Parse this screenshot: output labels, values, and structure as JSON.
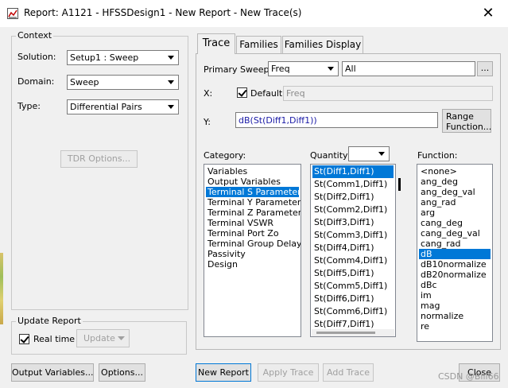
{
  "window": {
    "title": "Report: A1121 - HFSSDesign1 - New Report - New Trace(s)",
    "close_glyph": "✕"
  },
  "context": {
    "group_label": "Context",
    "solution": {
      "label": "Solution:",
      "value": "Setup1 : Sweep"
    },
    "domain": {
      "label": "Domain:",
      "value": "Sweep"
    },
    "type": {
      "label": "Type:",
      "value": "Differential Pairs"
    },
    "tdr_button": "TDR Options..."
  },
  "update_report": {
    "group_label": "Update Report",
    "realtime_label": "Real time",
    "realtime_checked": true,
    "update_button": "Update"
  },
  "bottom_left": {
    "output_variables": "Output Variables...",
    "options": "Options..."
  },
  "tabs": [
    {
      "label": "Trace",
      "active": true
    },
    {
      "label": "Families"
    },
    {
      "label": "Families Display"
    }
  ],
  "trace": {
    "primary_sweep_label": "Primary Sweep:",
    "primary_sweep_value": "Freq",
    "sweep_range": "All",
    "ellipsis": "...",
    "x_label": "X:",
    "default_label": "Default",
    "default_checked": true,
    "x_value": "Freq",
    "y_label": "Y:",
    "y_value": "dB(St(Diff1,Diff1))",
    "range_button_line1": "Range",
    "range_button_line2": "Function..."
  },
  "category": {
    "label": "Category:",
    "items": [
      "Variables",
      "Output Variables",
      "Terminal S Parameter",
      "Terminal Y Parameter",
      "Terminal Z Parameter",
      "Terminal VSWR",
      "Terminal Port Zo",
      "Terminal Group Delay",
      "Passivity",
      "Design"
    ],
    "selected_index": 2
  },
  "quantity": {
    "label": "Quantity:",
    "filter_value": "",
    "items": [
      "St(Diff1,Diff1)",
      "St(Comm1,Diff1)",
      "St(Diff2,Diff1)",
      "St(Comm2,Diff1)",
      "St(Diff3,Diff1)",
      "St(Comm3,Diff1)",
      "St(Diff4,Diff1)",
      "St(Comm4,Diff1)",
      "St(Diff5,Diff1)",
      "St(Comm5,Diff1)",
      "St(Diff6,Diff1)",
      "St(Comm6,Diff1)",
      "St(Diff7,Diff1)"
    ],
    "selected_index": 0
  },
  "function": {
    "label": "Function:",
    "items": [
      "<none>",
      "ang_deg",
      "ang_deg_val",
      "ang_rad",
      "arg",
      "cang_deg",
      "cang_deg_val",
      "cang_rad",
      "dB",
      "dB10normalize",
      "dB20normalize",
      "dBc",
      "im",
      "mag",
      "normalize",
      "re"
    ],
    "selected_index": 8
  },
  "bottom_buttons": {
    "new_report": "New Report",
    "apply_trace": "Apply Trace",
    "add_trace": "Add Trace",
    "close": "Close"
  },
  "watermark": "CSDN @Bill66",
  "colors": {
    "selection": "#0078d7",
    "y_text": "#1a1aa6"
  }
}
